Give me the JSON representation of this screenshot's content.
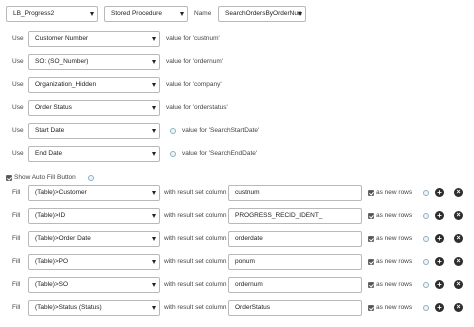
{
  "header": {
    "connection": "LB_Progress2",
    "type": "Stored Procedure",
    "name_label": "Name",
    "name_value": "SearchOrdersByOrderNun"
  },
  "use_rows": [
    {
      "use": "Use",
      "field": "Customer Number",
      "value_text": "value for 'custnum'",
      "has_info": false
    },
    {
      "use": "Use",
      "field": "SO: (SO_Number)",
      "value_text": "value for 'ordernum'",
      "has_info": false
    },
    {
      "use": "Use",
      "field": "Organization_Hidden",
      "value_text": "value for 'company'",
      "has_info": false
    },
    {
      "use": "Use",
      "field": "Order Status",
      "value_text": "value for 'orderstatus'",
      "has_info": false
    },
    {
      "use": "Use",
      "field": "Start Date",
      "value_text": "value for 'SearchStartDate'",
      "has_info": true
    },
    {
      "use": "Use",
      "field": "End Date",
      "value_text": "value for 'SearchEndDate'",
      "has_info": true
    }
  ],
  "autofill": {
    "label": "Show Auto Fill Button",
    "checked": true
  },
  "fill_rows": [
    {
      "fill": "Fill",
      "field": "(Table)>Customer",
      "with_text": "with result set column",
      "column": "custnum",
      "as_new_rows": "as new rows"
    },
    {
      "fill": "Fill",
      "field": "(Table)>ID",
      "with_text": "with result set column",
      "column": "PROGRESS_RECID_IDENT_",
      "as_new_rows": "as new rows"
    },
    {
      "fill": "Fill",
      "field": "(Table)>Order Date",
      "with_text": "with result set column",
      "column": "orderdate",
      "as_new_rows": "as new rows"
    },
    {
      "fill": "Fill",
      "field": "(Table)>PO",
      "with_text": "with result set column",
      "column": "ponum",
      "as_new_rows": "as new rows"
    },
    {
      "fill": "Fill",
      "field": "(Table)>SO",
      "with_text": "with result set column",
      "column": "ordernum",
      "as_new_rows": "as new rows"
    },
    {
      "fill": "Fill",
      "field": "(Table)>Status (Status)",
      "with_text": "with result set column",
      "column": "OrderStatus",
      "as_new_rows": "as new rows"
    }
  ],
  "icons": {
    "add": "+",
    "remove": "×"
  }
}
